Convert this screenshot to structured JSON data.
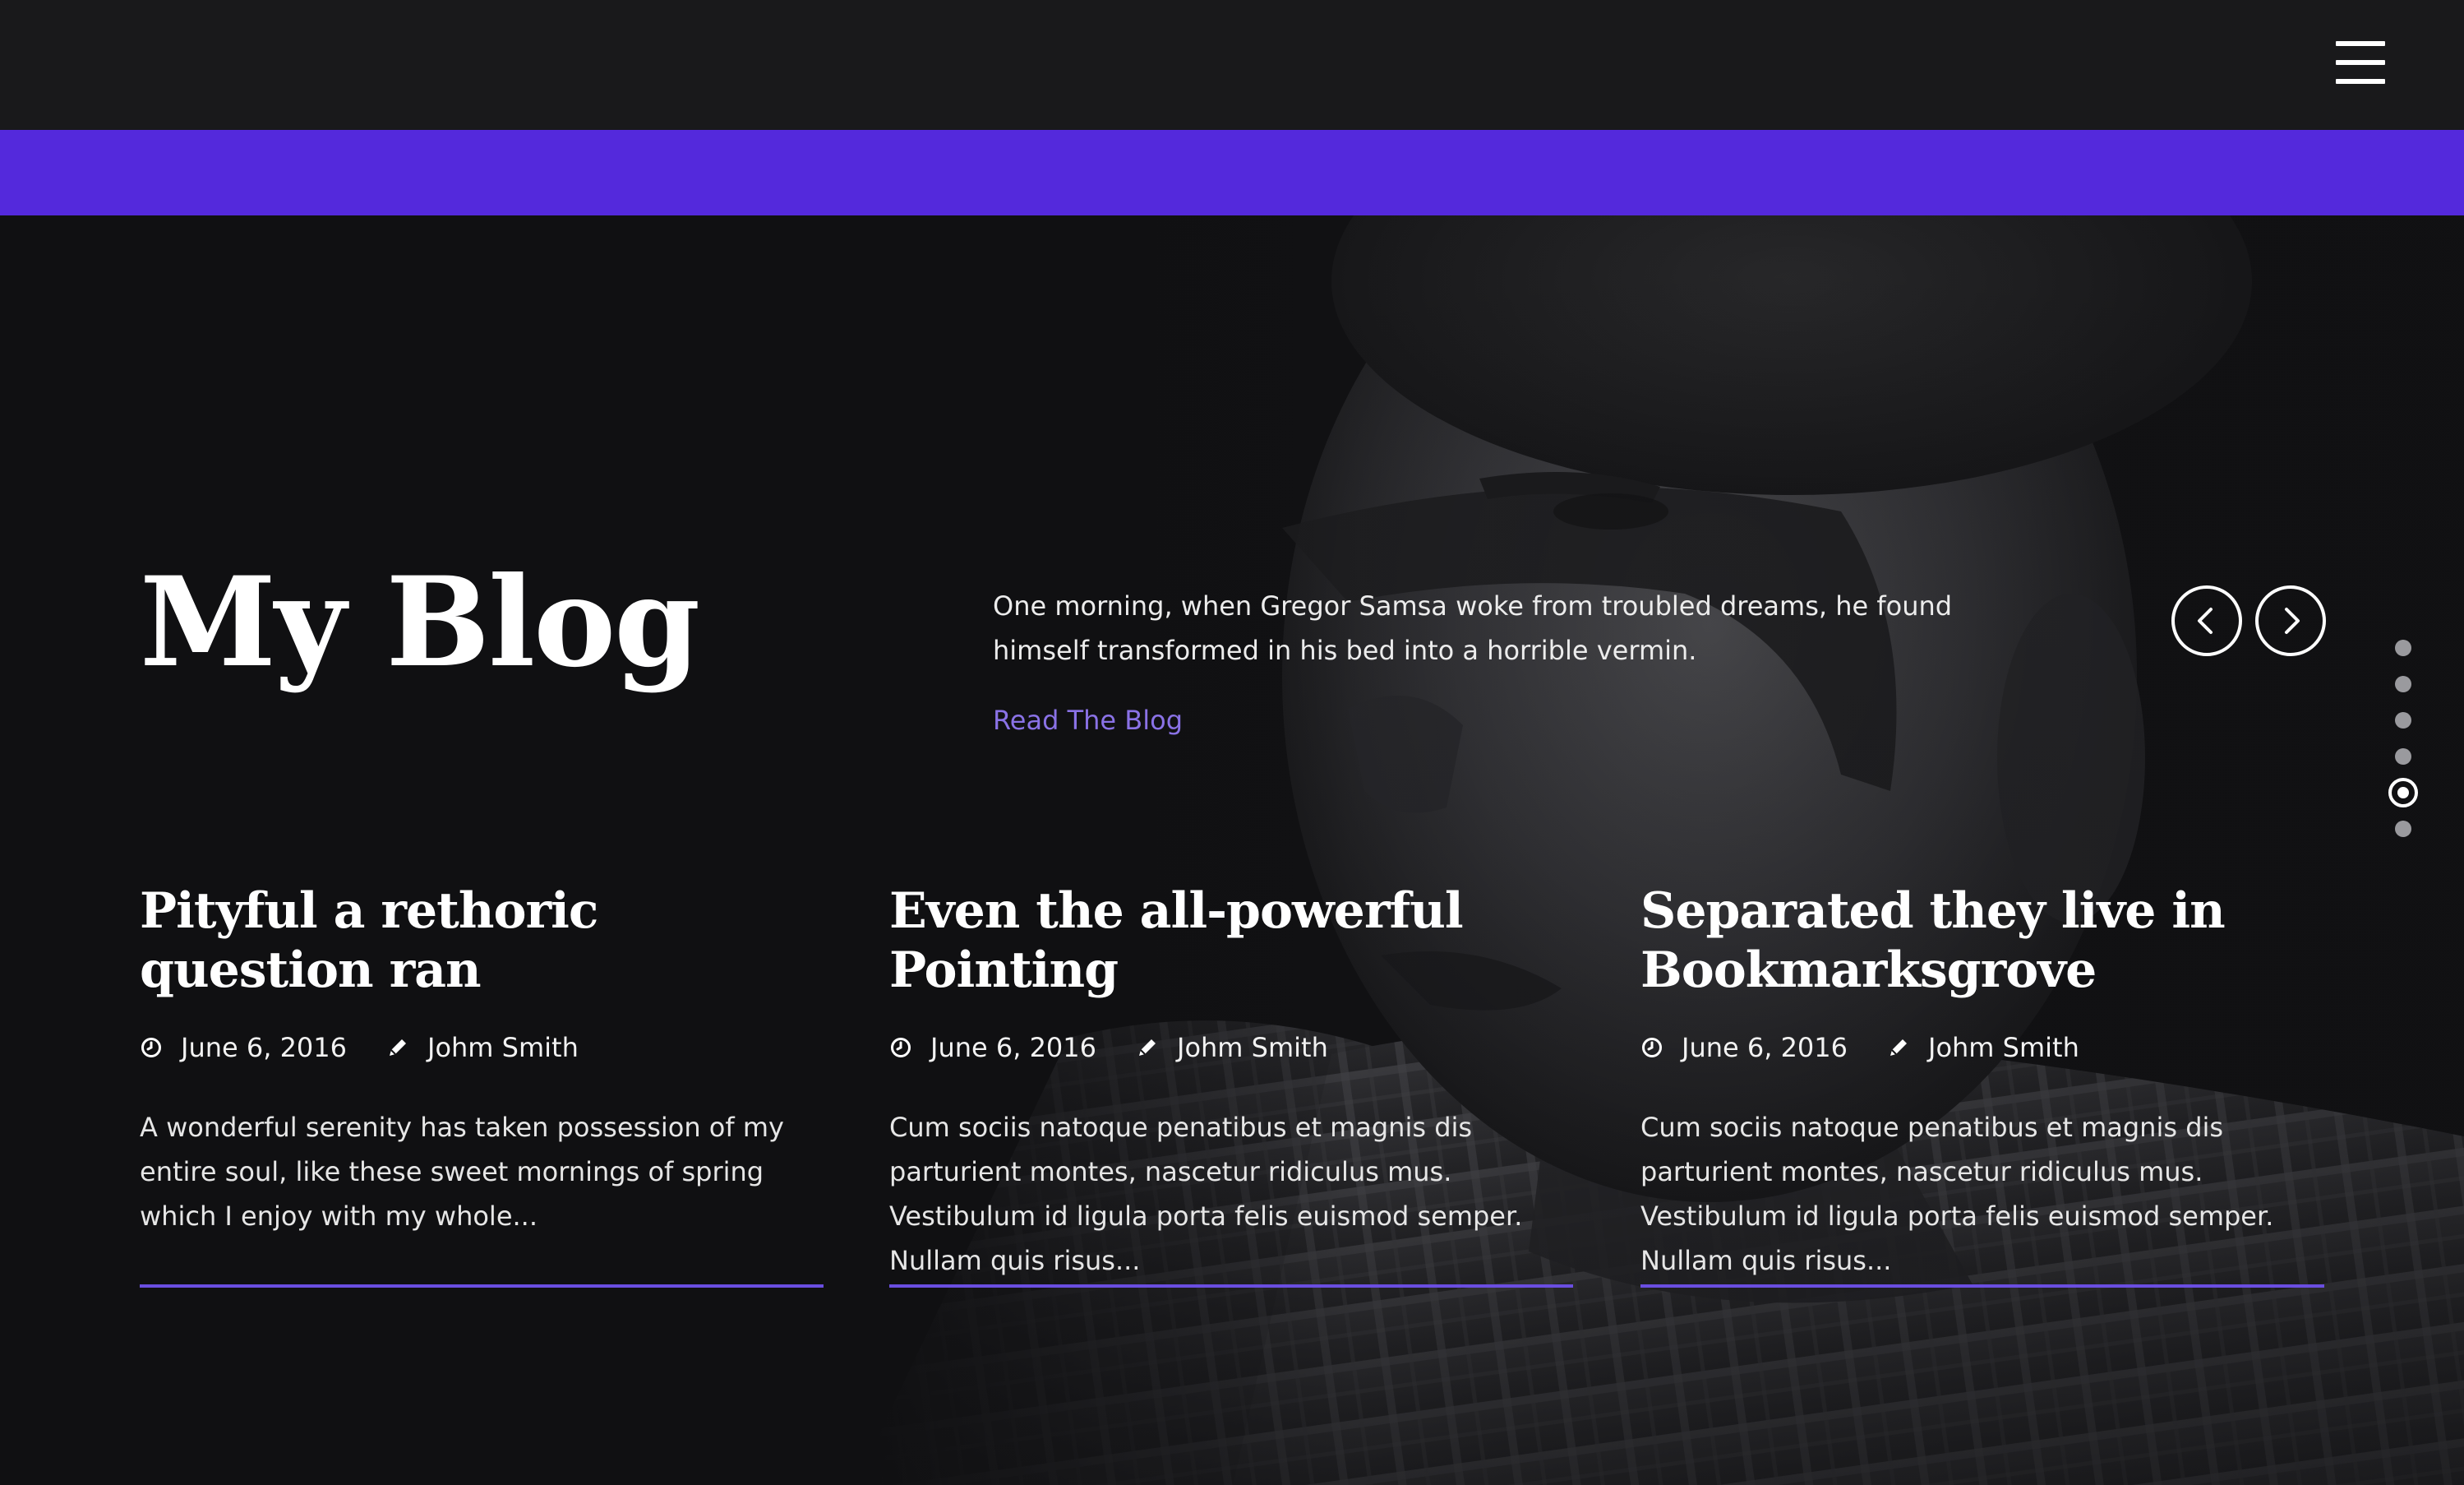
{
  "header": {
    "menu_icon": "hamburger-menu-icon"
  },
  "colors": {
    "accent": "#5429dc",
    "link": "#8a72e6",
    "rule": "#6a4ee0",
    "background": "#141416"
  },
  "hero": {
    "title": "My Blog",
    "intro": "One morning, when Gregor Samsa woke from troubled dreams, he found himself transformed in his bed into a horrible vermin.",
    "read_link": "Read The Blog",
    "prev_icon": "chevron-left-icon",
    "next_icon": "chevron-right-icon",
    "slides": {
      "count": 6,
      "active_index": 4
    }
  },
  "posts": [
    {
      "title": "Pityful a rethoric question ran",
      "date": "June 6, 2016",
      "author": "Johm Smith",
      "excerpt": "A wonderful serenity has taken possession of my entire soul, like these sweet mornings of spring which I enjoy with my whole..."
    },
    {
      "title": "Even the all-powerful Pointing",
      "date": "June 6, 2016",
      "author": "Johm Smith",
      "excerpt": "Cum sociis natoque penatibus et magnis dis parturient montes, nascetur ridiculus mus. Vestibulum id ligula porta felis euismod semper. Nullam quis risus..."
    },
    {
      "title": "Separated they live in Bookmarksgrove",
      "date": "June 6, 2016",
      "author": "Johm Smith",
      "excerpt": "Cum sociis natoque penatibus et magnis dis parturient montes, nascetur ridiculus mus. Vestibulum id ligula porta felis euismod semper. Nullam quis risus..."
    }
  ]
}
